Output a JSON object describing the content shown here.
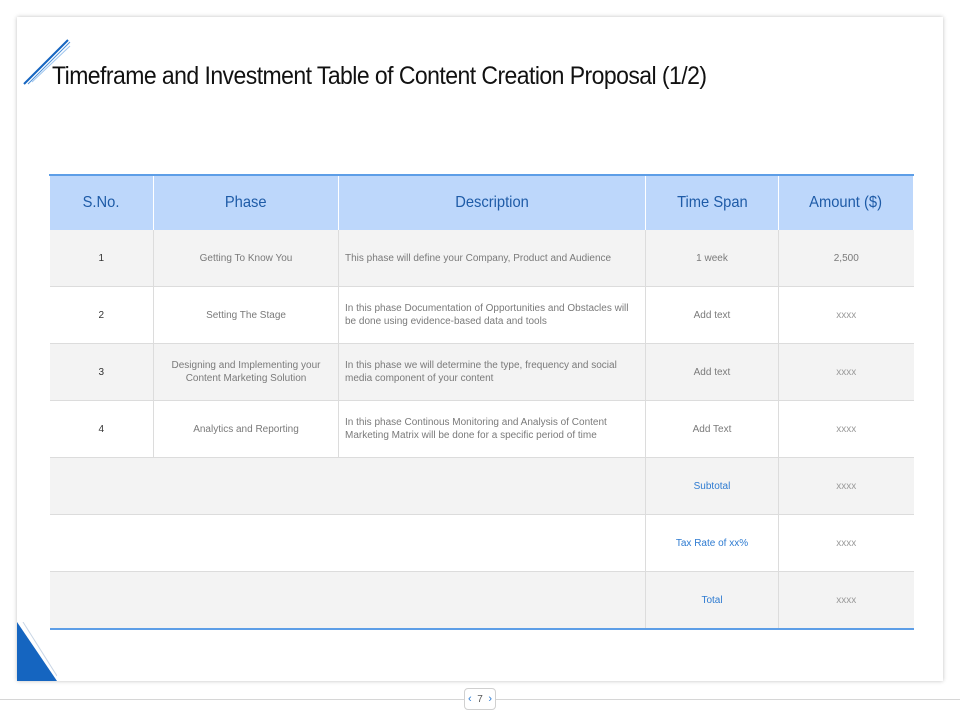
{
  "title": "Timeframe and Investment Table of Content Creation Proposal (1/2)",
  "table": {
    "headers": [
      "S.No.",
      "Phase",
      "Description",
      "Time Span",
      "Amount ($)"
    ],
    "rows": [
      {
        "sno": "1",
        "phase": "Getting To Know You",
        "description": "This phase will define your Company, Product and Audience",
        "time_span": "1 week",
        "amount": "2,500"
      },
      {
        "sno": "2",
        "phase": "Setting The Stage",
        "description": "In this phase Documentation of Opportunities and Obstacles will be done using evidence-based data and tools",
        "time_span": "Add text",
        "amount": "xxxx"
      },
      {
        "sno": "3",
        "phase": "Designing and Implementing your Content Marketing Solution",
        "description": "In this phase we will determine the type, frequency and social media component of your content",
        "time_span": "Add text",
        "amount": "xxxx"
      },
      {
        "sno": "4",
        "phase": "Analytics and Reporting",
        "description": "In this phase Continous Monitoring and Analysis of Content Marketing Matrix will be done for a specific period of time",
        "time_span": "Add Text",
        "amount": "xxxx"
      }
    ],
    "summary": [
      {
        "label": "Subtotal",
        "amount": "xxxx"
      },
      {
        "label": "Tax Rate of xx%",
        "amount": "xxxx"
      },
      {
        "label": "Total",
        "amount": "xxxx"
      }
    ]
  },
  "pager": {
    "prev_icon": "chevron-left-icon",
    "page": "7",
    "next_icon": "chevron-right-icon"
  },
  "colors": {
    "accent": "#2e7bd1",
    "header_bg": "#bdd7fb",
    "header_text": "#1e5ba7",
    "corner": "#1565c0"
  }
}
